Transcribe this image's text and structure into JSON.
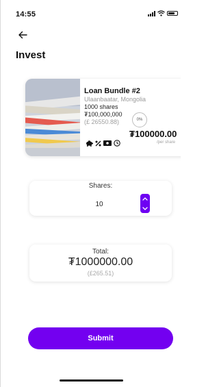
{
  "status_bar": {
    "time": "14:55"
  },
  "header": {
    "title": "Invest"
  },
  "loan": {
    "title": "Loan Bundle #2",
    "location": "Ulaanbaatar, Mongolia",
    "shares": "1000 shares",
    "amount": "₮100,000,000",
    "amount_gbp": "(£ 26550.88)",
    "progress": "0%",
    "price_per_share": "₮100000.00",
    "per_share_label": "/per share",
    "feature_icons": [
      "piggy-bank-icon",
      "percent-icon",
      "cash-icon",
      "clock-icon"
    ]
  },
  "shares_input": {
    "label": "Shares:",
    "value": "10"
  },
  "total": {
    "label": "Total:",
    "value": "₮1000000.00",
    "gbp": "(£265.51)"
  },
  "submit": {
    "label": "Submit"
  },
  "colors": {
    "accent": "#7300f0"
  }
}
